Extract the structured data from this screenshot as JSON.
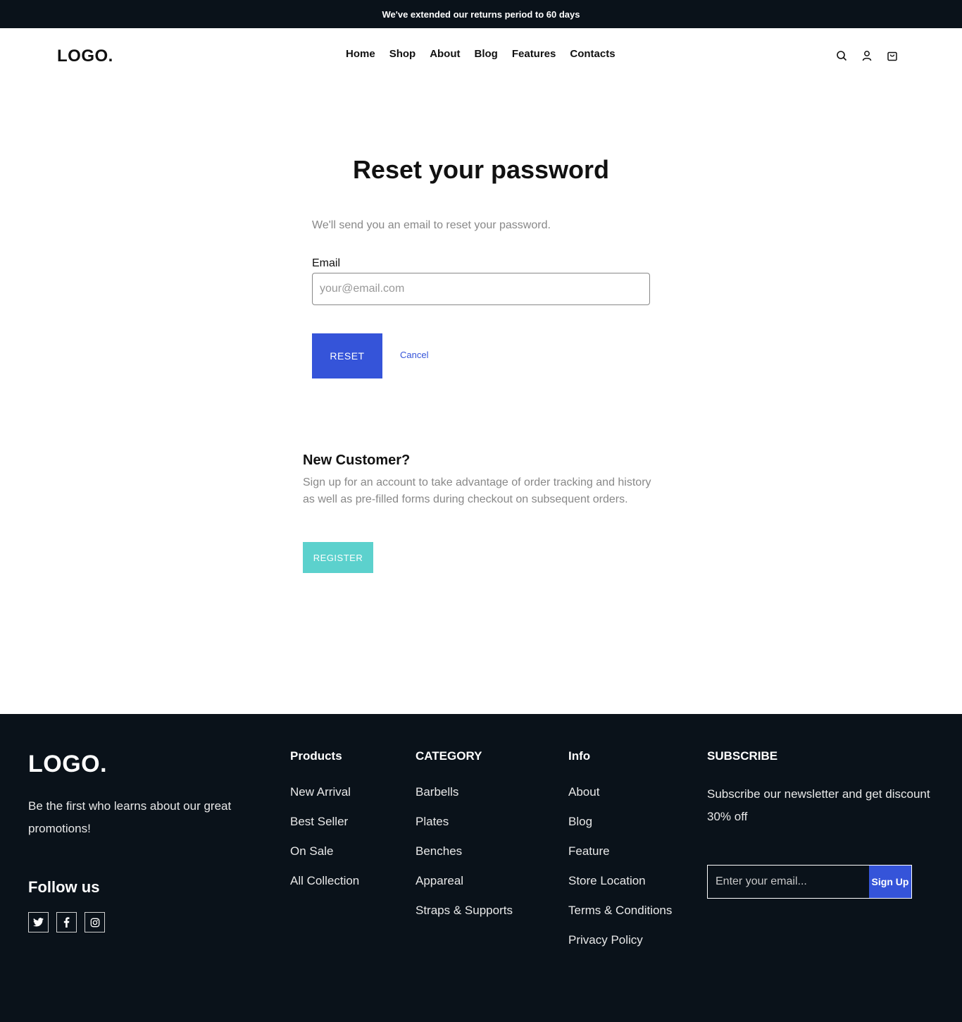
{
  "announcement": "We've extended our returns period to 60 days",
  "header": {
    "logo": "LOGO.",
    "nav": [
      "Home",
      "Shop",
      "About",
      "Blog",
      "Features",
      "Contacts"
    ],
    "icons": [
      "search-icon",
      "user-icon",
      "cart-icon"
    ]
  },
  "reset": {
    "title": "Reset your password",
    "description": "We'll send you an email to reset your password.",
    "email_label": "Email",
    "email_placeholder": "your@email.com",
    "email_value": "",
    "reset_label": "RESET",
    "cancel_label": "Cancel"
  },
  "new_customer": {
    "title": "New Customer?",
    "text": "Sign up for an account to take advantage of order tracking and history as well as pre-filled forms during checkout on subsequent orders.",
    "register_label": "REGISTER"
  },
  "footer": {
    "logo": "LOGO.",
    "tagline": "Be the first who learns about our great promotions!",
    "follow_title": "Follow us",
    "social_icons": [
      "twitter-icon",
      "facebook-icon",
      "instagram-icon"
    ],
    "products": {
      "title": "Products",
      "items": [
        "New Arrival",
        "Best Seller",
        "On Sale",
        "All Collection"
      ]
    },
    "category": {
      "title": "CATEGORY",
      "items": [
        "Barbells",
        "Plates",
        "Benches",
        "Appareal",
        "Straps & Supports"
      ]
    },
    "info": {
      "title": "Info",
      "items": [
        "About",
        "Blog",
        "Feature",
        "Store Location",
        "Terms & Conditions",
        "Privacy Policy"
      ]
    },
    "subscribe": {
      "title": "SUBSCRIBE",
      "text": "Subscribe our newsletter and get discount 30% off",
      "placeholder": "Enter your email...",
      "button_label": "Sign Up"
    }
  },
  "colors": {
    "dark": "#0a121a",
    "accent_blue": "#3554d9",
    "accent_teal": "#5cd1cd",
    "muted_text": "#888888"
  }
}
